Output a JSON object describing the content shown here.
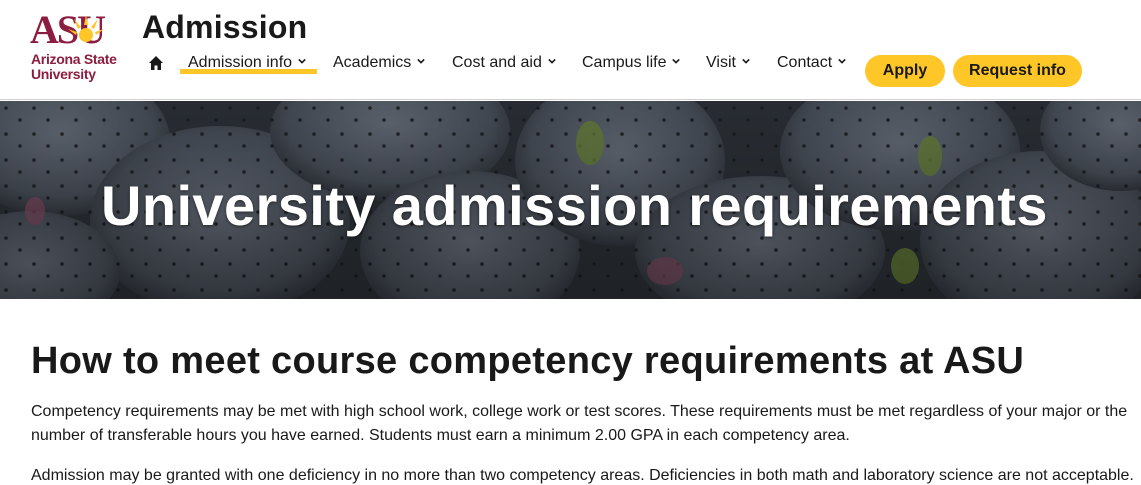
{
  "logo": {
    "mark": "ASU",
    "line1": "Arizona State",
    "line2": "University",
    "brand_color": "#8c1d40",
    "gold": "#ffc627"
  },
  "header": {
    "site_title": "Admission",
    "home_icon": "home-icon"
  },
  "nav": {
    "items": [
      {
        "label": "Admission info",
        "active": true
      },
      {
        "label": "Academics"
      },
      {
        "label": "Cost and aid"
      },
      {
        "label": "Campus life"
      },
      {
        "label": "Visit"
      },
      {
        "label": "Contact"
      }
    ],
    "chevron_icon": "chevron-down-icon"
  },
  "buttons": {
    "apply": "Apply",
    "request_info": "Request info"
  },
  "hero": {
    "title": "University admission requirements"
  },
  "content": {
    "heading": "How to meet course competency requirements at ASU",
    "paragraph1": "Competency requirements may be met with high school work, college work or test scores. These requirements must be met regardless of your major or the number of transferable hours you have earned. Students must earn a minimum 2.00 GPA in each competency area.",
    "paragraph2": "Admission may be granted with one deficiency in no more than two competency areas. Deficiencies in both math and laboratory science are not acceptable."
  }
}
